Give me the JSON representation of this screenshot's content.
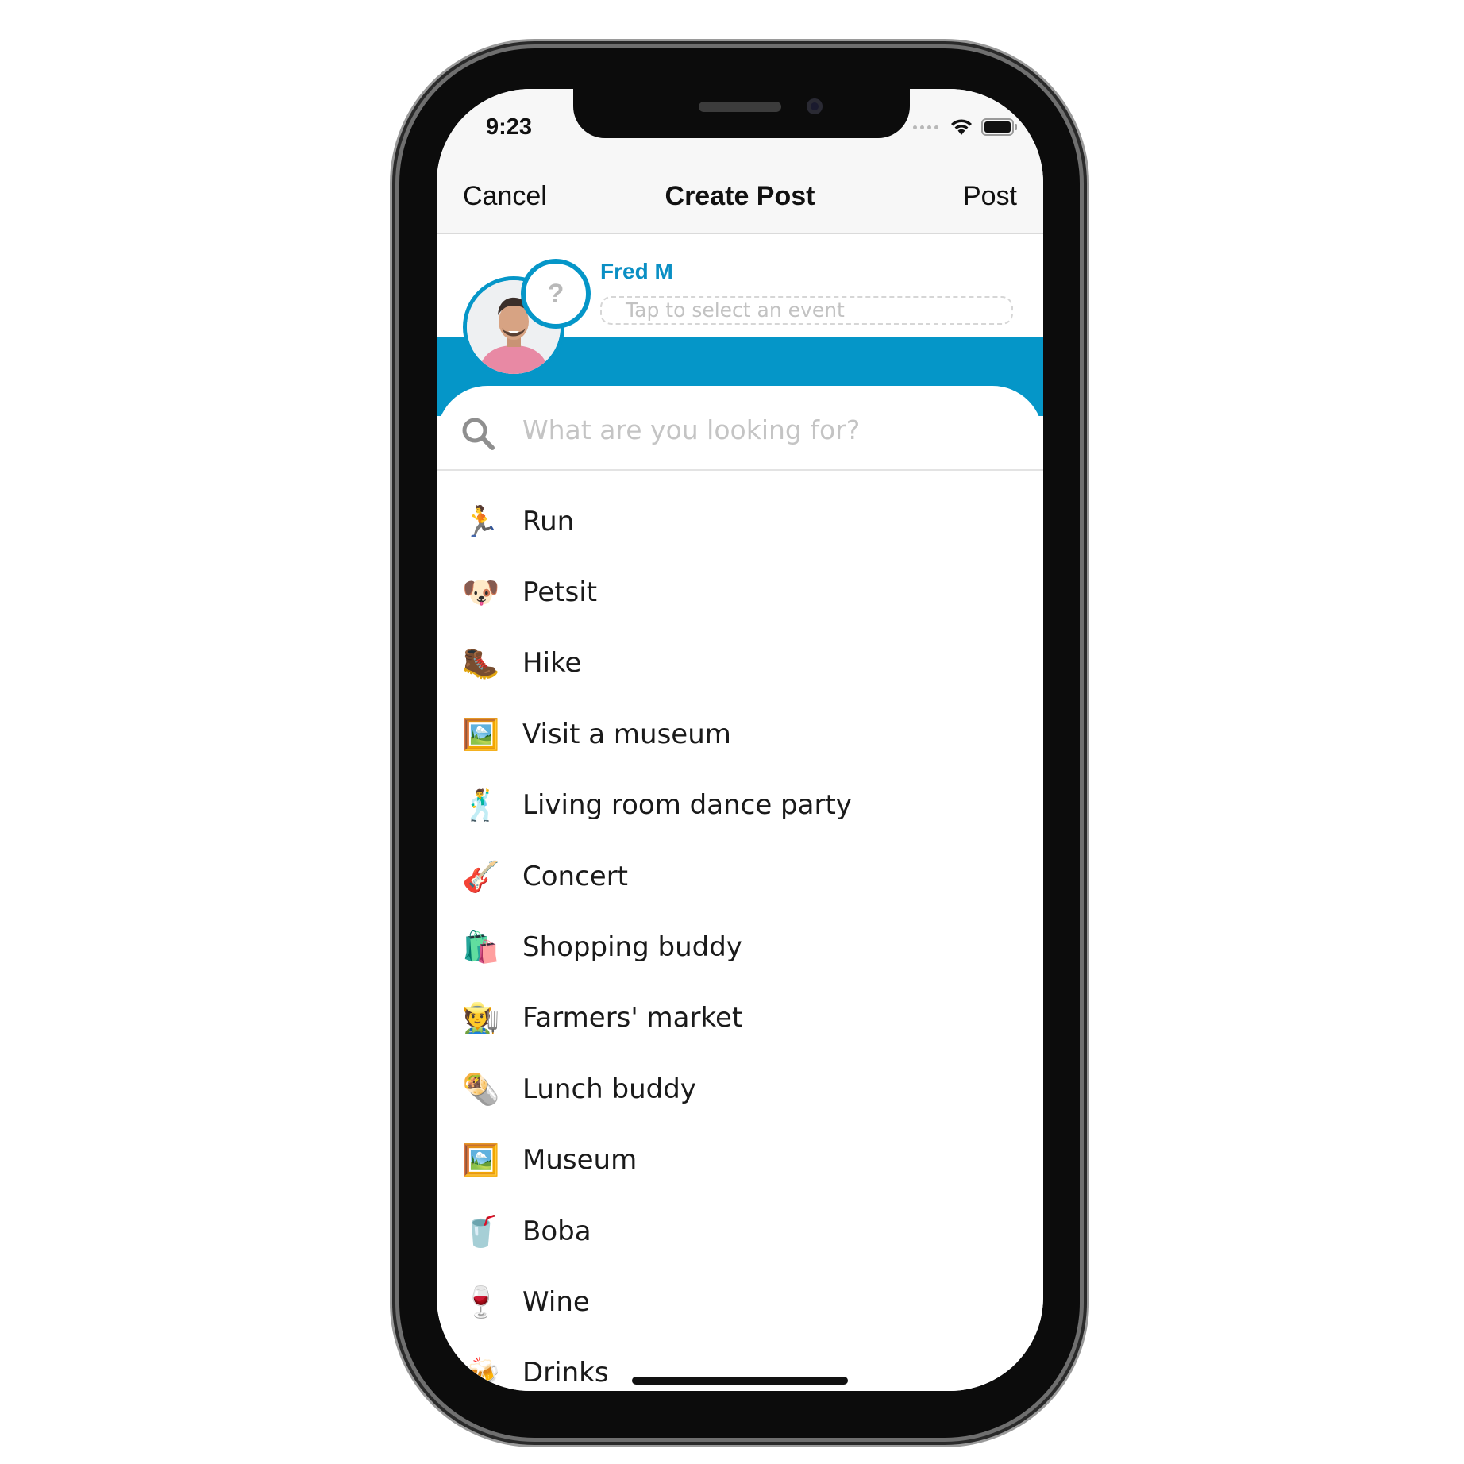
{
  "status_bar": {
    "time": "9:23"
  },
  "nav": {
    "cancel_label": "Cancel",
    "title": "Create Post",
    "post_label": "Post"
  },
  "header": {
    "user_name": "Fred M",
    "event_placeholder": "Tap to select an event",
    "event_bubble_glyph": "?",
    "accent_color": "#0596c8"
  },
  "search": {
    "placeholder": "What are you looking for?"
  },
  "activities": [
    {
      "emoji": "🏃",
      "label": "Run"
    },
    {
      "emoji": "🐶",
      "label": "Petsit"
    },
    {
      "emoji": "🥾",
      "label": "Hike"
    },
    {
      "emoji": "🖼️",
      "label": "Visit a museum"
    },
    {
      "emoji": "🕺",
      "label": "Living room dance party"
    },
    {
      "emoji": "🎸",
      "label": "Concert"
    },
    {
      "emoji": "🛍️",
      "label": "Shopping buddy"
    },
    {
      "emoji": "🧑‍🌾",
      "label": "Farmers' market"
    },
    {
      "emoji": "🌯",
      "label": "Lunch buddy"
    },
    {
      "emoji": "🖼️",
      "label": "Museum"
    },
    {
      "emoji": "🥤",
      "label": "Boba"
    },
    {
      "emoji": "🍷",
      "label": "Wine"
    },
    {
      "emoji": "🍻",
      "label": "Drinks"
    }
  ]
}
